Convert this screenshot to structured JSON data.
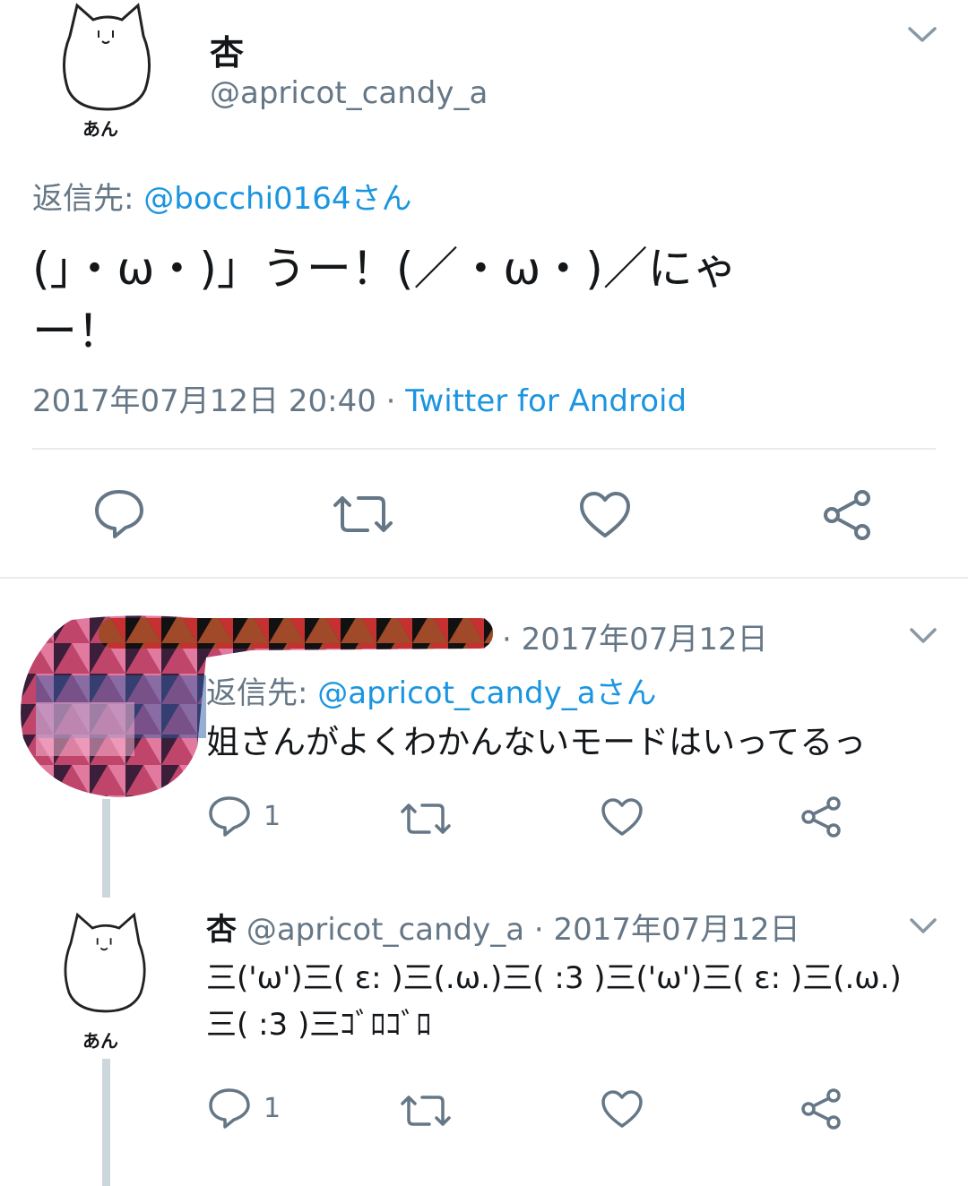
{
  "main_tweet": {
    "avatar_caption": "あん",
    "name": "杏",
    "handle": "@apricot_candy_a",
    "reply_prefix": "返信先: ",
    "reply_to": "@bocchi0164さん",
    "text_line1": "(」・ω・)」うー！(／・ω・)／にゃ",
    "text_line2": "ー！",
    "datetime": "2017年07月12日 20:40 · ",
    "source": "Twitter for Android"
  },
  "reply1": {
    "meta": "· 2017年07月12日",
    "reply_prefix": "返信先: ",
    "reply_to": "@apricot_candy_aさん",
    "text": "姐さんがよくわかんないモードはいってるっ",
    "reply_count": "1"
  },
  "reply2": {
    "avatar_caption": "あん",
    "name": "杏",
    "meta": "@apricot_candy_a · 2017年07月12日",
    "text_line1": "三('ω')三( ε: )三(.ω.)三( :3 )三('ω')三( ε: )三(.ω.)",
    "text_line2": "三( :3 )三ｺﾞﾛｺﾞﾛ",
    "reply_count": "1"
  },
  "icons": {
    "reply": "reply-icon",
    "retweet": "retweet-icon",
    "like": "heart-icon",
    "share": "share-icon",
    "menu": "chevron-down-icon"
  },
  "colors": {
    "link": "#1b95e0",
    "secondary_text": "#657786",
    "icon": "#657786",
    "divider": "#e6ecf0"
  }
}
